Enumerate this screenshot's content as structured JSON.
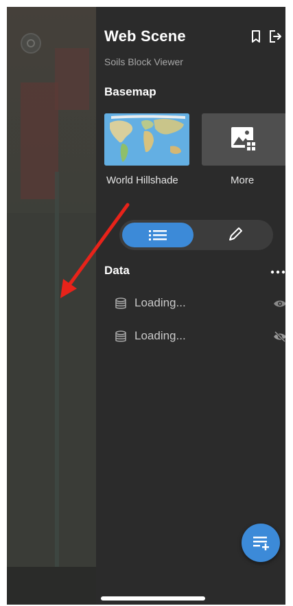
{
  "panel": {
    "title": "Web Scene",
    "subtitle": "Soils Block Viewer"
  },
  "header": {
    "bookmark_icon": "bookmark-icon",
    "sign_out_icon": "sign-out-icon"
  },
  "basemap": {
    "heading": "Basemap",
    "tiles": [
      {
        "label": "World Hillshade",
        "icon": "world-map-thumbnail"
      },
      {
        "label": "More",
        "icon": "image-gallery-icon"
      }
    ]
  },
  "view_toggle": {
    "options": [
      {
        "icon": "list-icon",
        "selected": true
      },
      {
        "icon": "pencil-icon",
        "selected": false
      }
    ]
  },
  "data": {
    "heading": "Data",
    "menu_icon": "more-options-icon",
    "layers": [
      {
        "label": "Loading...",
        "icon": "layer-stack-icon",
        "visibility_icon": "eye-icon"
      },
      {
        "label": "Loading...",
        "icon": "layer-stack-icon",
        "visibility_icon": "eye-off-icon"
      }
    ]
  },
  "fab": {
    "icon": "add-layer-icon"
  },
  "colors": {
    "accent": "#3c8ad8",
    "panel_bg": "#2b2b2b",
    "annotation_arrow": "#e8231a"
  }
}
